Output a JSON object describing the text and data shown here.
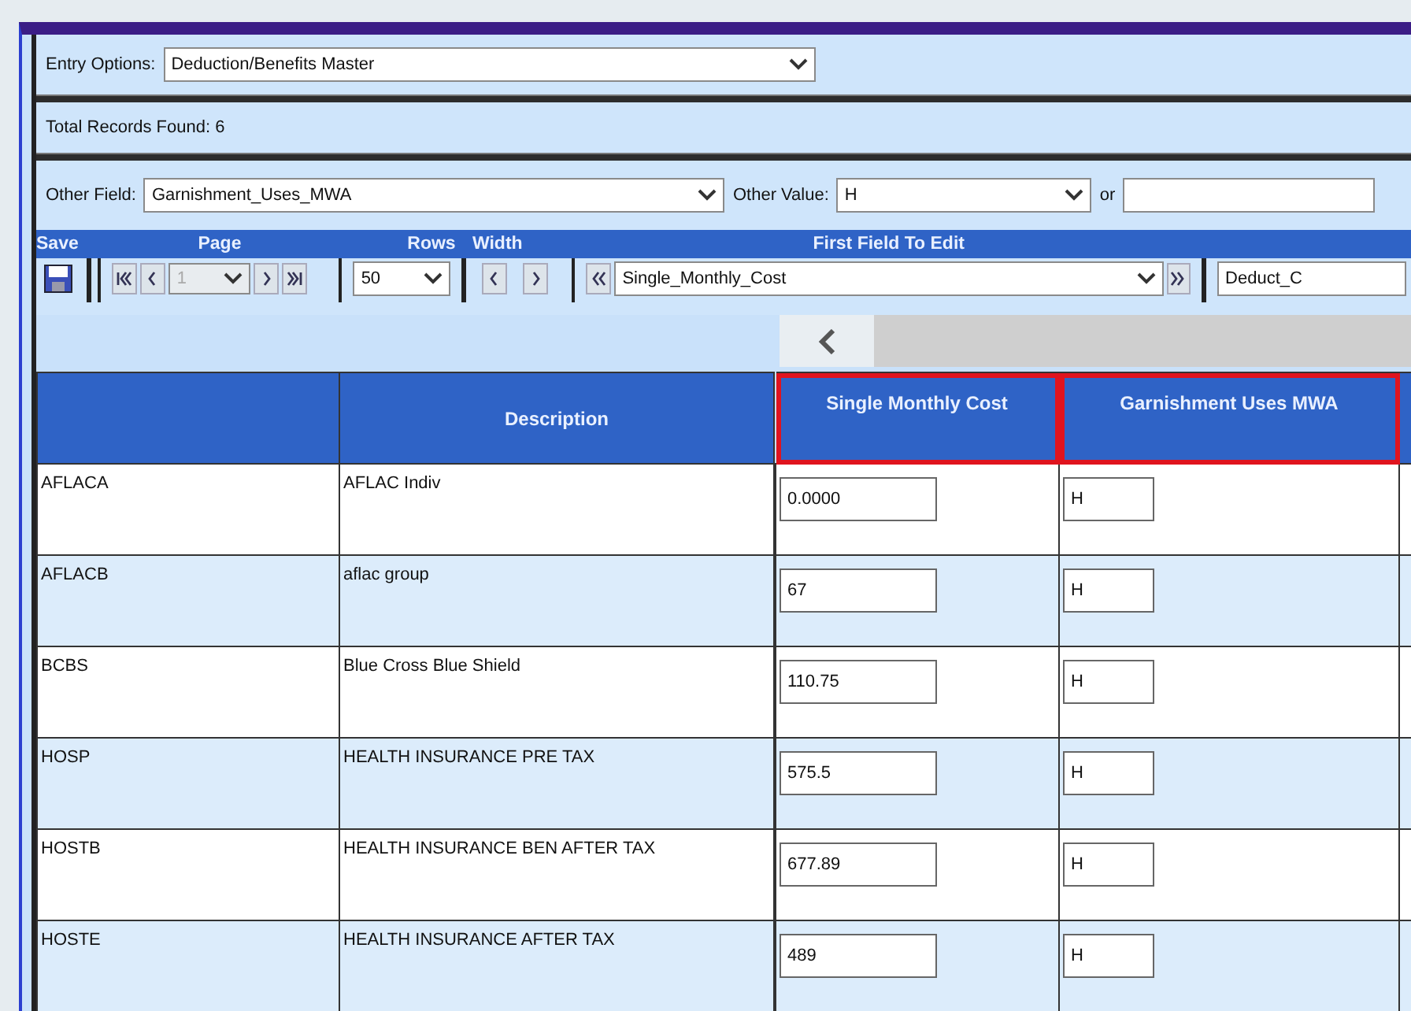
{
  "entry_options": {
    "label": "Entry Options:",
    "value": "Deduction/Benefits Master"
  },
  "total_records": "Total Records Found: 6",
  "other_field": {
    "label": "Other Field:",
    "value": "Garnishment_Uses_MWA"
  },
  "other_value": {
    "label": "Other Value:",
    "value": "H"
  },
  "or_label": "or",
  "toolbar": {
    "save_label": "Save",
    "page_label": "Page",
    "page_value": "1",
    "page_disabled": true,
    "rows_label": "Rows",
    "rows_value": "50",
    "width_label": "Width",
    "first_field_label": "First Field To Edit",
    "first_field_value": "Single_Monthly_Cost",
    "next_field_value": "Deduct_C"
  },
  "table": {
    "left_columns": [
      "Description"
    ],
    "right_columns": [
      {
        "label": "Single Monthly Cost",
        "highlighted": true
      },
      {
        "label": "Garnishment Uses MWA",
        "highlighted": true
      }
    ],
    "rows": [
      {
        "code": "AFLACA",
        "description": "AFLAC Indiv",
        "single_monthly_cost": "0.0000",
        "garnishment_uses_mwa": "H"
      },
      {
        "code": "AFLACB",
        "description": "aflac group",
        "single_monthly_cost": "67",
        "garnishment_uses_mwa": "H"
      },
      {
        "code": "BCBS",
        "description": "Blue Cross Blue Shield",
        "single_monthly_cost": "110.75",
        "garnishment_uses_mwa": "H"
      },
      {
        "code": "HOSP",
        "description": "HEALTH INSURANCE PRE TAX",
        "single_monthly_cost": "575.5",
        "garnishment_uses_mwa": "H"
      },
      {
        "code": "HOSTB",
        "description": "HEALTH INSURANCE BEN AFTER TAX",
        "single_monthly_cost": "677.89",
        "garnishment_uses_mwa": "H"
      },
      {
        "code": "HOSTE",
        "description": "HEALTH INSURANCE AFTER TAX",
        "single_monthly_cost": "489",
        "garnishment_uses_mwa": "H"
      }
    ]
  }
}
